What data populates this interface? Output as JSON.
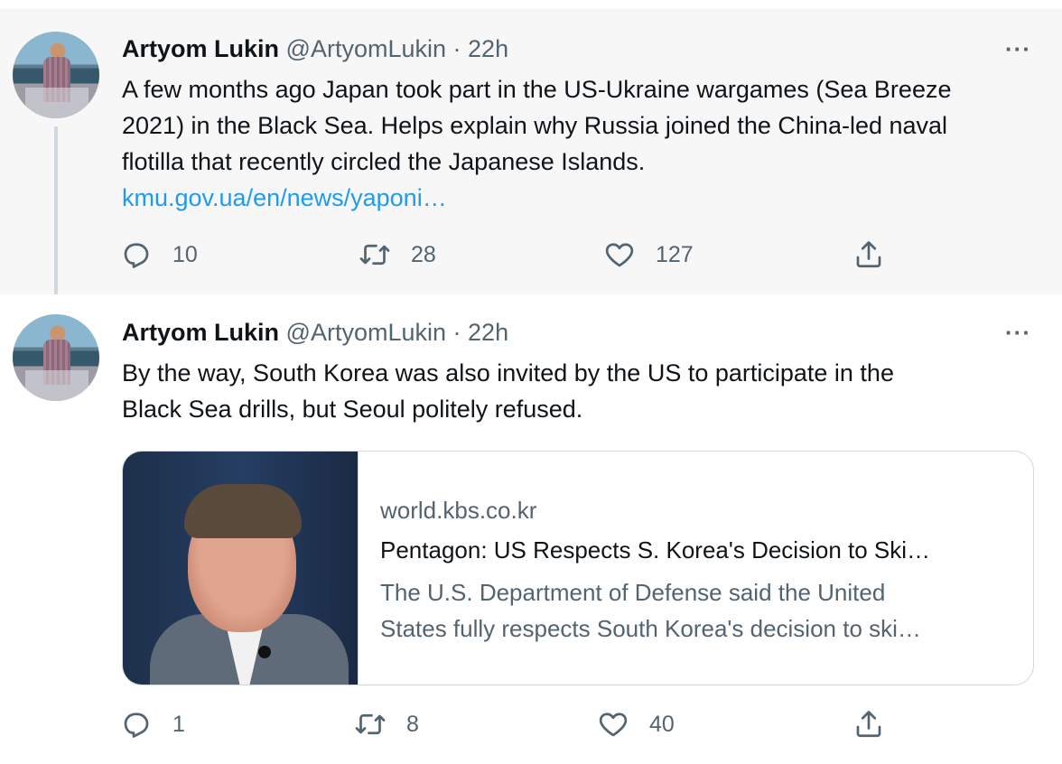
{
  "tweets": [
    {
      "author_name": "Artyom Lukin",
      "handle": "@ArtyomLukin",
      "separator": "·",
      "time": "22h",
      "more": "···",
      "text_lines": [
        "A few months ago Japan took part in the US-Ukraine wargames (Sea Breeze",
        "2021) in the Black Sea. Helps explain why Russia joined the China-led naval",
        "flotilla that recently circled the Japanese Islands."
      ],
      "link": "kmu.gov.ua/en/news/yaponi…",
      "replies": "10",
      "retweets": "28",
      "likes": "127"
    },
    {
      "author_name": "Artyom Lukin",
      "handle": "@ArtyomLukin",
      "separator": "·",
      "time": "22h",
      "more": "···",
      "text_lines": [
        "By the way, South Korea was also invited by the US to participate in the",
        "Black Sea drills, but Seoul politely refused."
      ],
      "card": {
        "domain": "world.kbs.co.kr",
        "title": "Pentagon: US Respects S. Korea's Decision to Ski…",
        "desc_lines": [
          "The U.S. Department of Defense said the United",
          "States fully respects South Korea's decision to ski…"
        ]
      },
      "replies": "1",
      "retweets": "8",
      "likes": "40"
    }
  ],
  "colors": {
    "link": "#1d9bf0",
    "secondary_text": "#536471",
    "primary_text": "#0f1419",
    "thread_line": "#cfd9de"
  }
}
